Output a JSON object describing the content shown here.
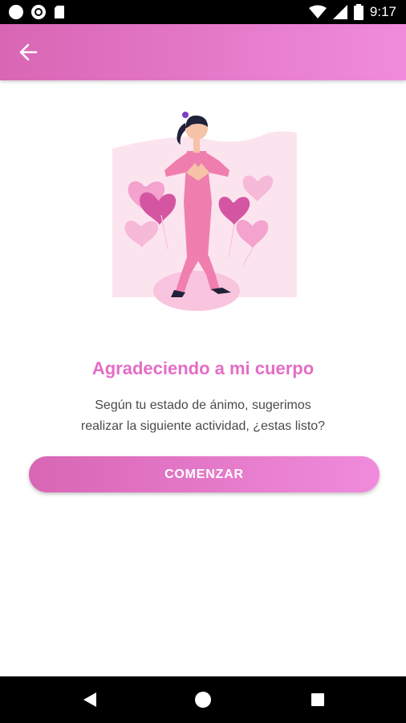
{
  "status_bar": {
    "time": "9:17",
    "left_icons": [
      "circle-icon",
      "sync-icon",
      "sd-card-icon"
    ],
    "right_icons": [
      "wifi-icon",
      "signal-icon",
      "battery-icon"
    ]
  },
  "app_bar": {
    "back_icon": "arrow-left-icon",
    "gradient": [
      "#d866b4",
      "#f08bdc"
    ]
  },
  "content": {
    "illustration": "woman-heart-hands-balloons",
    "title": "Agradeciendo a mi cuerpo",
    "description_line1": "Según tu estado de ánimo, sugerimos",
    "description_line2": "realizar la siguiente actividad, ¿estas listo?",
    "button_label": "COMENZAR"
  },
  "nav_bar": {
    "icons": [
      "back-triangle-icon",
      "home-circle-icon",
      "recents-square-icon"
    ]
  },
  "colors": {
    "accent": "#e46cc6",
    "text": "#4a4a4a"
  }
}
